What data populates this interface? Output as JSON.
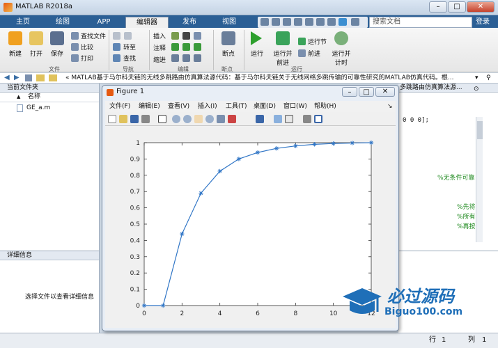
{
  "window": {
    "title": "MATLAB R2018a",
    "min": "–",
    "max": "□",
    "close": "✕"
  },
  "tabs": [
    {
      "label": "主页"
    },
    {
      "label": "绘图"
    },
    {
      "label": "APP"
    },
    {
      "label": "编辑器"
    },
    {
      "label": "发布"
    },
    {
      "label": "视图"
    }
  ],
  "search": {
    "placeholder": "搜索文档"
  },
  "login": "登录",
  "ribbon": {
    "file": {
      "new": "新建",
      "open": "打开",
      "save": "保存",
      "find_files": "查找文件",
      "compare": "比较",
      "print": "打印",
      "group": "文件"
    },
    "nav": {
      "goto": "转至",
      "find": "查找",
      "group": "导航"
    },
    "edit": {
      "insert": "插入",
      "comment": "注释",
      "indent": "缩进",
      "group": "编辑"
    },
    "breakpoints": {
      "label": "断点",
      "group": "断点"
    },
    "run": {
      "run": "运行",
      "run_advance": "运行并\n前进",
      "run_section": "运行节",
      "advance": "前进",
      "run_time": "运行并\n计时",
      "group": "运行"
    }
  },
  "path": {
    "text": "« MATLAB基于马尔科夫链的无线多跳路由仿真算法源代码：基于马尔科夫链关于无线网络多跳传输的可靠性研究的MATLAB仿真代码。根..."
  },
  "left": {
    "title": "当前文件夹",
    "col": "名称",
    "sort": "▲",
    "file": "GE_a.m"
  },
  "detail": {
    "title": "详细信息",
    "empty": "选择文件以查看详细信息"
  },
  "editor": {
    "tab": "多跳路由仿真算法源...",
    "code1": "0 0 0];",
    "comment1": "%无条件可靠",
    "comment2": "%先将",
    "comment3": "%所有",
    "comment4": "%再按"
  },
  "status": {
    "row_label": "行",
    "row": "1",
    "col_label": "列",
    "col": "1"
  },
  "figure": {
    "title": "Figure 1",
    "menu": [
      {
        "label": "文件(F)"
      },
      {
        "label": "编辑(E)"
      },
      {
        "label": "查看(V)"
      },
      {
        "label": "插入(I)"
      },
      {
        "label": "工具(T)"
      },
      {
        "label": "桌面(D)"
      },
      {
        "label": "窗口(W)"
      },
      {
        "label": "帮助(H)"
      }
    ],
    "dock": "↘"
  },
  "watermark": {
    "text": "必过源码",
    "url": "Biguo100.com"
  },
  "chart_data": {
    "type": "line",
    "x": [
      0,
      1,
      2,
      3,
      4,
      5,
      6,
      7,
      8,
      9,
      10,
      11,
      12
    ],
    "series": [
      {
        "values": [
          0,
          0,
          0.44,
          0.69,
          0.825,
          0.9,
          0.94,
          0.965,
          0.98,
          0.99,
          0.995,
          0.998,
          1.0
        ],
        "color": "#2f75c6",
        "marker": "*"
      }
    ],
    "xlim": [
      0,
      12
    ],
    "ylim": [
      0,
      1
    ],
    "xticks": [
      "0",
      "2",
      "4",
      "6",
      "8",
      "10",
      "12"
    ],
    "yticks": [
      "0",
      "0.1",
      "0.2",
      "0.3",
      "0.4",
      "0.5",
      "0.6",
      "0.7",
      "0.8",
      "0.9",
      "1"
    ],
    "grid": false,
    "title": "",
    "xlabel": "",
    "ylabel": ""
  }
}
